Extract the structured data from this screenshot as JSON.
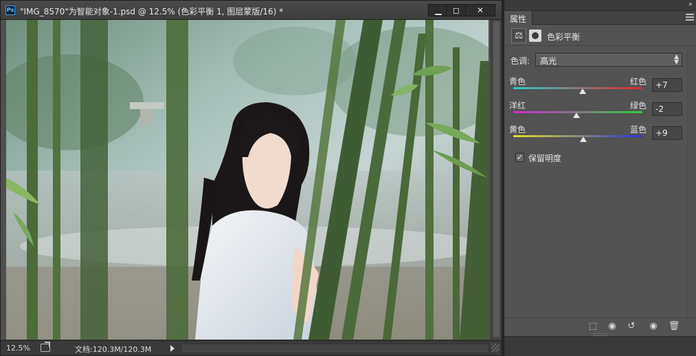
{
  "document": {
    "app_icon": "Ps",
    "title": "\"IMG_8570\"为智能对象-1.psd @ 12.5% (色彩平衡 1, 图层蒙版/16) *",
    "window_buttons": {
      "minimize": "▁",
      "maximize": "◻",
      "close": "✕"
    },
    "status": {
      "zoom": "12.5%",
      "doc_size": "文档:120.3M/120.3M"
    }
  },
  "panel": {
    "collapse": "»",
    "tab": "属性",
    "adjustment_icon": "⚖",
    "title": "色彩平衡",
    "tone_label": "色调:",
    "tone_value": "高光",
    "sliders": [
      {
        "left": "青色",
        "right": "红色",
        "value": "+7",
        "position": 0.535,
        "left_color": "#2ec9c9",
        "right_color": "#e02a2a"
      },
      {
        "left": "洋红",
        "right": "绿色",
        "value": "-2",
        "position": 0.49,
        "left_color": "#d12ad1",
        "right_color": "#2ecc3c"
      },
      {
        "left": "黄色",
        "right": "蓝色",
        "value": "+9",
        "position": 0.545,
        "left_color": "#e4df2a",
        "right_color": "#2a35d6"
      }
    ],
    "preserve_luminosity": {
      "label": "保留明度",
      "checked": true,
      "mark": "✓"
    },
    "footer_icons": [
      "clip-to-layer-icon",
      "view-previous-icon",
      "reset-icon",
      "visibility-icon",
      "delete-icon"
    ],
    "footer_glyphs": [
      "⬚",
      "◉",
      "↺",
      "◉",
      "🗑"
    ]
  },
  "colors": {
    "panel_bg": "#535353",
    "canvas_bg": "#505050"
  }
}
